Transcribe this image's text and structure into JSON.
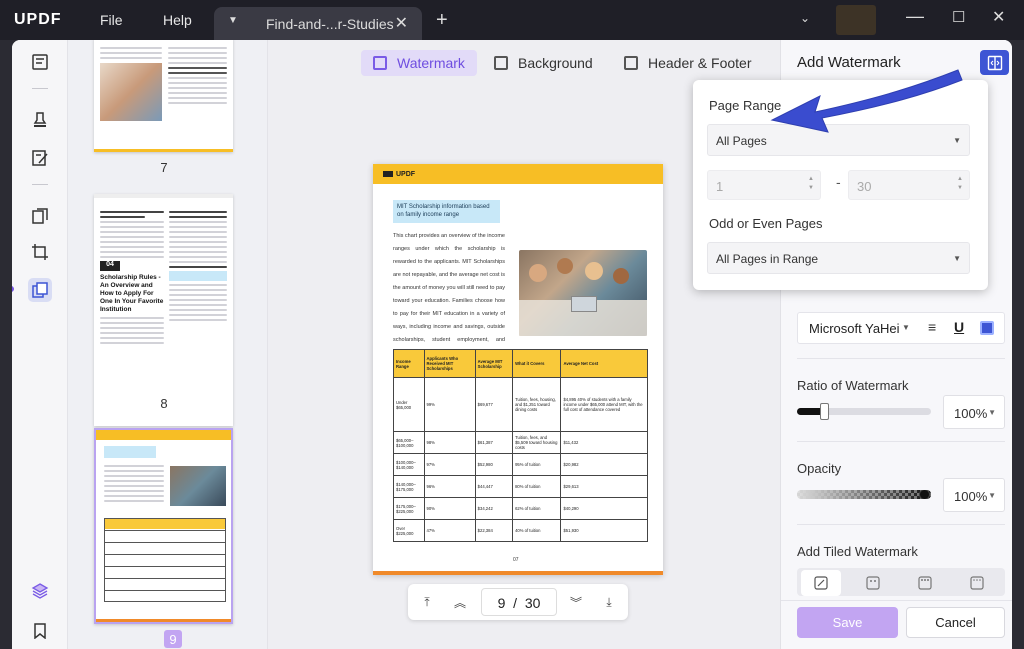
{
  "app": {
    "logo_main": "UPDF",
    "menu_file": "File",
    "menu_help": "Help"
  },
  "tab": {
    "title": "Find-and-...r-Studies"
  },
  "thumbnails": {
    "pages": [
      "7",
      "8",
      "9"
    ],
    "thumb8_heading": "Scholarship Rules - An Overview and How to Apply For One In Your Favorite Institution",
    "thumb8_num": "04"
  },
  "view_tabs": {
    "watermark": "Watermark",
    "background": "Background",
    "header_footer": "Header & Footer"
  },
  "doc": {
    "brand": "UPDF",
    "box_title": "MIT Scholarship information based on family income range",
    "body": "This chart provides an overview of the income ranges under which the scholarship is rewarded to the applicants. MIT Scholarships are not repayable, and the average net cost is the amount of money you will still need to pay toward your education. Families choose how to pay for their MIT education in a variety of ways, including income and savings, outside scholarships, student employment, and federal loans.",
    "page_number": "07",
    "table": {
      "headers": [
        "Income Range",
        "Applicants Who Received MIT Scholarships",
        "Average MIT Scholarship",
        "What it Covers",
        "Average Net Cost"
      ],
      "rows": [
        [
          "Under $65,000",
          "99%",
          "$69,677",
          "Tuition, fees, housing, and $1,251 toward dining costs",
          "$4,895 40% of students with a family income under $65,000 attend MIT, with the full cost of attendance covered"
        ],
        [
          "$65,000–$100,000",
          "98%",
          "$61,387",
          "Tuition, fees, and $5,509 toward housing costs",
          "$11,432"
        ],
        [
          "$100,000–$140,000",
          "97%",
          "$52,980",
          "95% of tuition",
          "$20,982"
        ],
        [
          "$140,000–$175,000",
          "96%",
          "$44,447",
          "80% of tuition",
          "$29,613"
        ],
        [
          "$175,000–$225,000",
          "90%",
          "$34,242",
          "62% of tuition",
          "$40,290"
        ],
        [
          "Over $225,000",
          "47%",
          "$22,384",
          "40% of tuition",
          "$51,930"
        ]
      ]
    }
  },
  "pager": {
    "current": "9",
    "separator": "/",
    "total": "30"
  },
  "panel": {
    "title": "Add Watermark",
    "font_name": "Microsoft YaHei",
    "ratio_label": "Ratio of Watermark",
    "ratio_value": "100%",
    "ratio_level": 0.2,
    "opacity_label": "Opacity",
    "opacity_value": "100%",
    "opacity_level": 1.0,
    "tiled_label": "Add Tiled Watermark",
    "save": "Save",
    "cancel": "Cancel"
  },
  "popup": {
    "page_range_label": "Page Range",
    "page_range_value": "All Pages",
    "from": "1",
    "dash": "-",
    "to": "30",
    "odd_even_label": "Odd or Even Pages",
    "odd_even_value": "All Pages in Range"
  },
  "colors": {
    "accent": "#7a5be6",
    "blue_button": "#3d55d4",
    "arrow": "#3a4ccf",
    "save_bg": "#c2a5f2",
    "yellow": "#f7be25"
  }
}
